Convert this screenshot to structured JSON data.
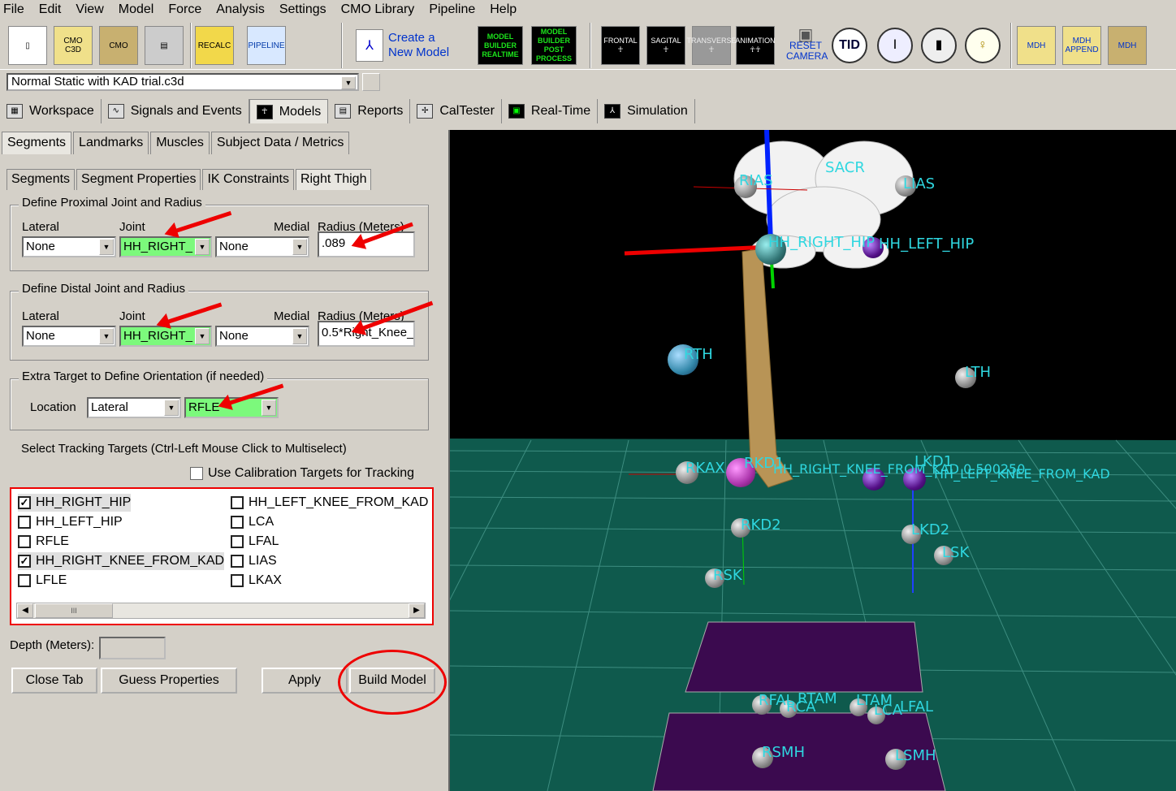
{
  "menu": [
    "File",
    "Edit",
    "View",
    "Model",
    "Force",
    "Analysis",
    "Settings",
    "CMO Library",
    "Pipeline",
    "Help"
  ],
  "toolbar": {
    "cmo_c3d": "CMO C3D",
    "cmo": "CMO",
    "recalc": "RECALC",
    "pipeline": "PIPELINE",
    "create_model": "Create a New Model",
    "mb_realtime": "MODEL BUILDER REALTIME",
    "mb_post": "MODEL BUILDER POST PROCESS",
    "frontal": "FRONTAL",
    "sagital": "SAGITAL",
    "transverse": "TRANSVERSE",
    "animation": "ANIMATION",
    "reset_camera": "RESET CAMERA",
    "mdh": "MDH",
    "mdh_append": "APPEND"
  },
  "file_combo": "Normal Static with KAD trial.c3d",
  "main_tabs": [
    "Workspace",
    "Signals and Events",
    "Models",
    "Reports",
    "CalTester",
    "Real-Time",
    "Simulation"
  ],
  "sub_tabs": [
    "Segments",
    "Landmarks",
    "Muscles",
    "Subject Data / Metrics"
  ],
  "segment_tabs": [
    "Segments",
    "Segment Properties",
    "IK Constraints",
    "Right Thigh"
  ],
  "proximal": {
    "title": "Define Proximal Joint and Radius",
    "lateral_label": "Lateral",
    "joint_label": "Joint",
    "medial_label": "Medial",
    "radius_label": "Radius (Meters)",
    "lateral": "None",
    "joint": "HH_RIGHT_",
    "medial": "None",
    "radius": ".089"
  },
  "distal": {
    "title": "Define Distal Joint and Radius",
    "lateral_label": "Lateral",
    "joint_label": "Joint",
    "medial_label": "Medial",
    "radius_label": "Radius (Meters)",
    "lateral": "None",
    "joint": "HH_RIGHT_",
    "medial": "None",
    "radius": "0.5*Right_Knee_"
  },
  "extra": {
    "title": "Extra Target to Define Orientation (if needed)",
    "location_label": "Location",
    "location": "Lateral",
    "target": "RFLE"
  },
  "tracking": {
    "title": "Select Tracking Targets (Ctrl-Left Mouse Click to Multiselect)",
    "use_calibration": "Use Calibration Targets for Tracking",
    "left_items": [
      {
        "label": "HH_RIGHT_HIP",
        "checked": true
      },
      {
        "label": "HH_LEFT_HIP",
        "checked": false
      },
      {
        "label": "RFLE",
        "checked": false
      },
      {
        "label": "HH_RIGHT_KNEE_FROM_KAD",
        "checked": true
      },
      {
        "label": "LFLE",
        "checked": false
      }
    ],
    "right_items": [
      {
        "label": "HH_LEFT_KNEE_FROM_KAD",
        "checked": false
      },
      {
        "label": "LCA",
        "checked": false
      },
      {
        "label": "LFAL",
        "checked": false
      },
      {
        "label": "LIAS",
        "checked": false
      },
      {
        "label": "LKAX",
        "checked": false
      }
    ],
    "scroll_thumb": "III"
  },
  "depth_label": "Depth (Meters):",
  "buttons": {
    "close_tab": "Close Tab",
    "guess": "Guess Properties",
    "apply": "Apply",
    "build": "Build Model"
  },
  "viewport_labels": {
    "rias": "RIAS",
    "sacr": "SACR",
    "lias": "LIAS",
    "hh_right_hip": "HH_RIGHT_HIP",
    "hh_left_hip": "HH_LEFT_HIP",
    "rth": "RTH",
    "lth": "LTH",
    "rkax": "RKAX",
    "rkd1": "RKD1",
    "knee_overlap": "HH_RIGHT_KNEE_FROM_KAD 0.500250",
    "lkd1": "LKD1",
    "hh_left_knee": "HH_LEFT_KNEE_FROM_KAD",
    "rkd2": "RKD2",
    "lkd2": "LKD2",
    "rsk": "RSK",
    "lsk": "LSK",
    "rfal": "RFAL",
    "rtam": "RTAM",
    "rca": "RCA",
    "ltam": "LTAM",
    "lca": "LCA",
    "lfal": "LFAL",
    "rsmh": "RSMH",
    "lsmh": "LSMH"
  },
  "colors": {
    "accent_green": "#7cf97c",
    "annotation_red": "#e00000",
    "label_cyan": "#2fd7e0",
    "floor": "#0f5a4d",
    "plate": "#3b0a4f"
  }
}
